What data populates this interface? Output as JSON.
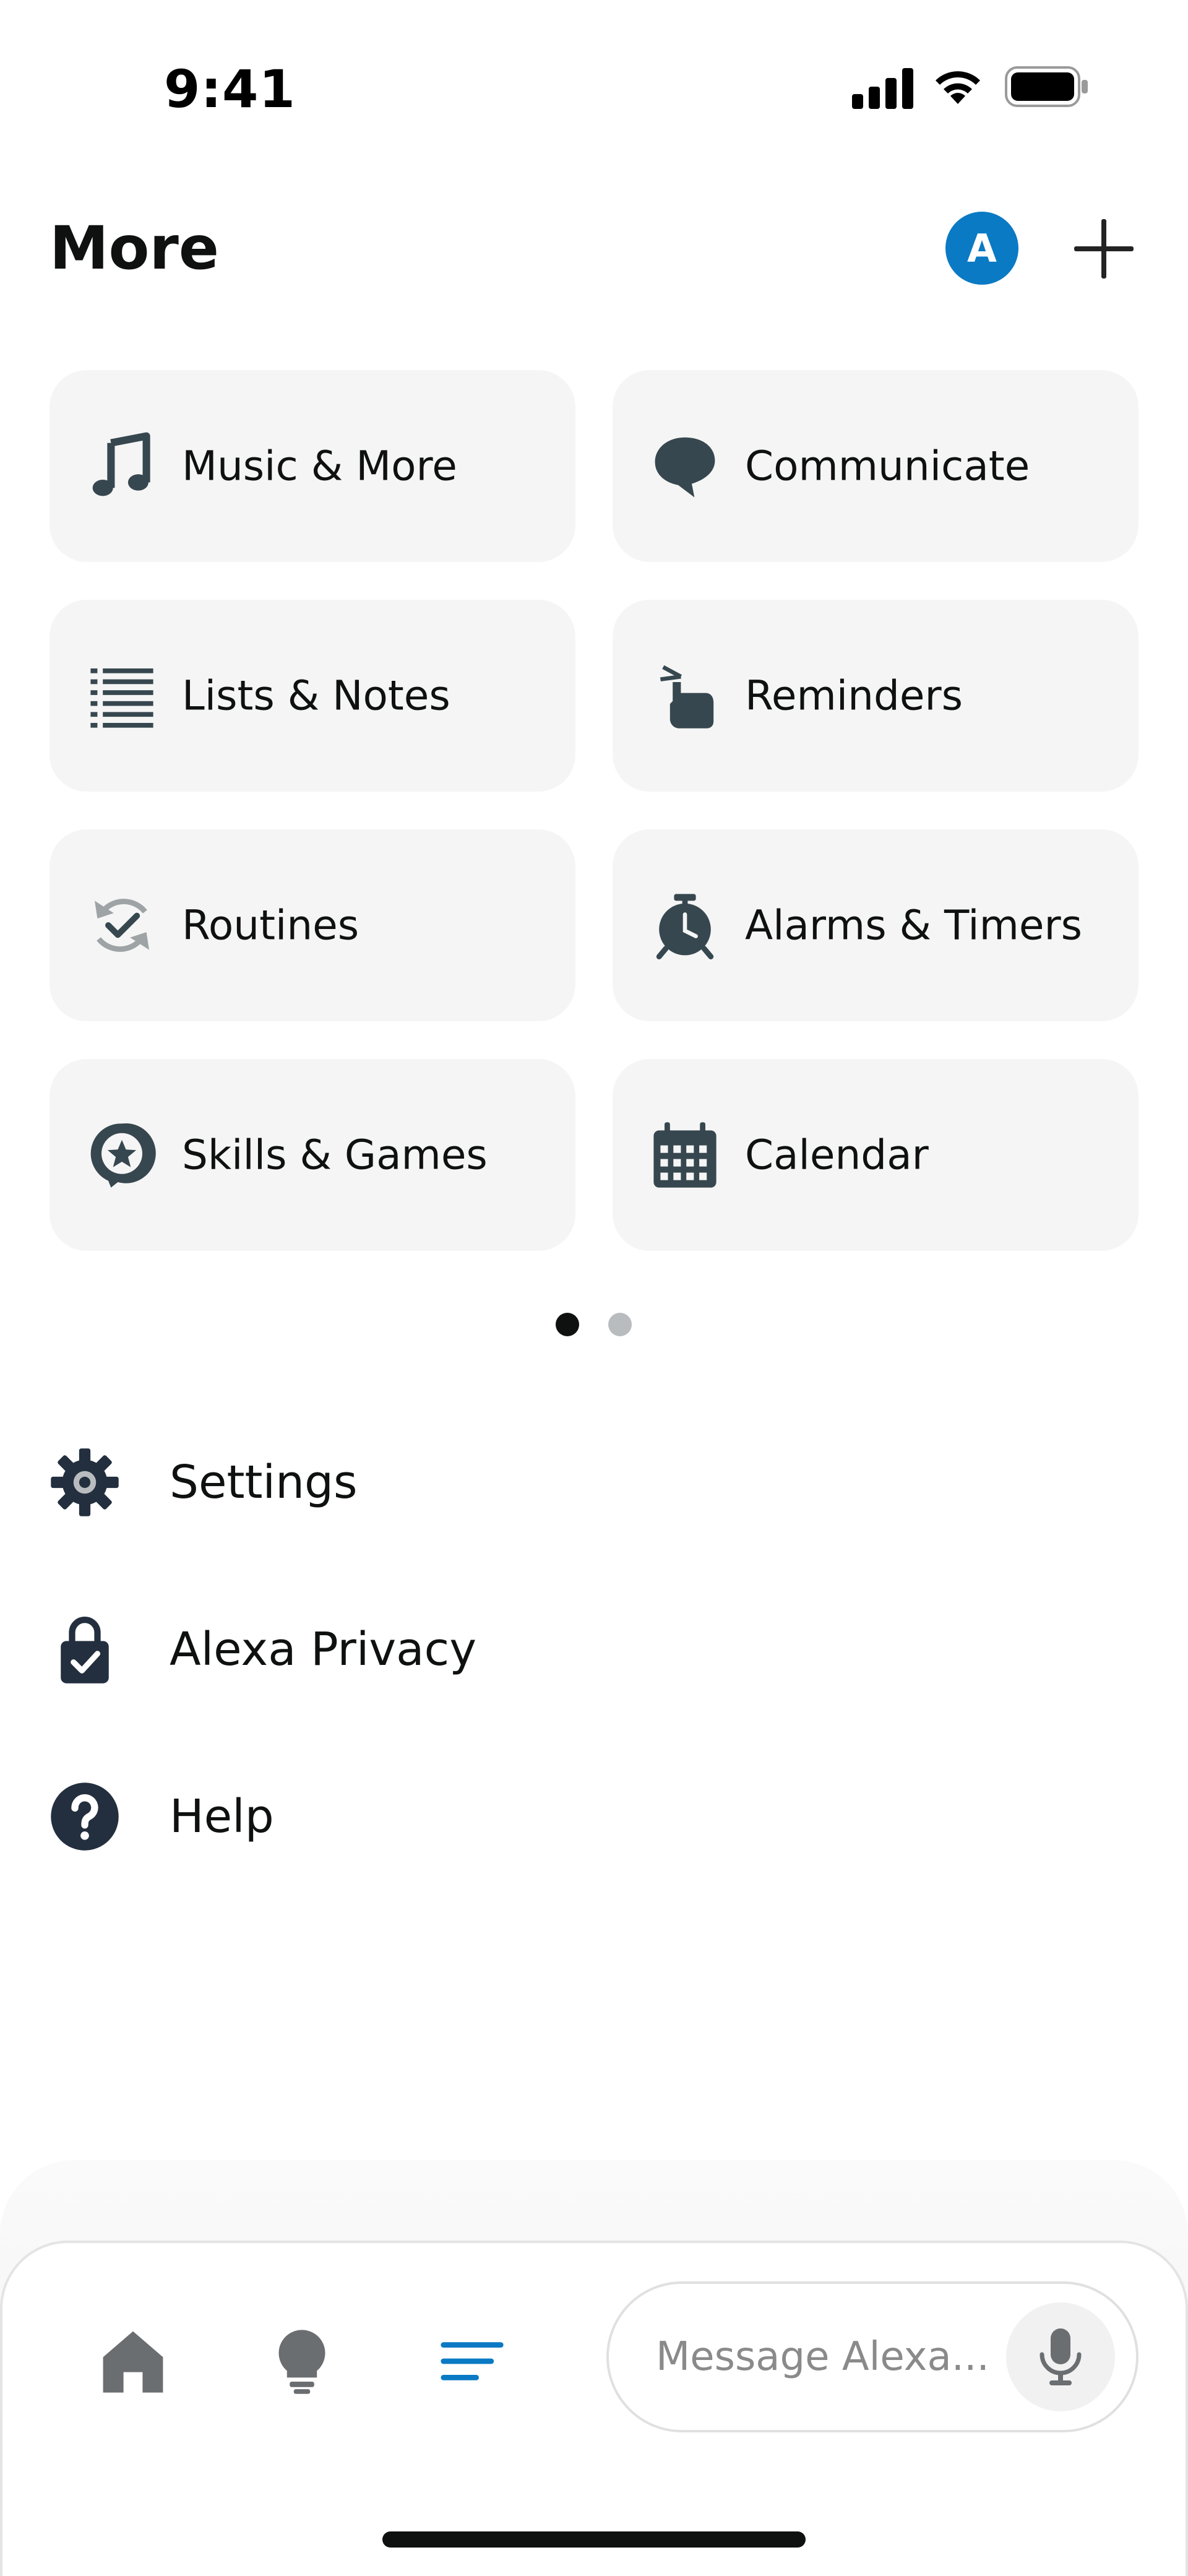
{
  "status_bar": {
    "time": "9:41",
    "icons": [
      "cellular-signal-icon",
      "wifi-icon",
      "battery-icon"
    ]
  },
  "header": {
    "title": "More",
    "avatar_initial": "A",
    "avatar_color": "#0a7ac4",
    "add_icon": "plus-icon"
  },
  "grid": {
    "page_count": 2,
    "active_page": 1,
    "tiles": [
      {
        "label": "Music & More",
        "icon": "music-note-icon"
      },
      {
        "label": "Communicate",
        "icon": "speech-bubble-icon"
      },
      {
        "label": "Lists & Notes",
        "icon": "list-icon"
      },
      {
        "label": "Reminders",
        "icon": "finger-string-icon"
      },
      {
        "label": "Routines",
        "icon": "routine-check-icon"
      },
      {
        "label": "Alarms & Timers",
        "icon": "alarm-clock-icon"
      },
      {
        "label": "Skills & Games",
        "icon": "star-bubble-icon"
      },
      {
        "label": "Calendar",
        "icon": "calendar-icon"
      }
    ]
  },
  "list": {
    "items": [
      {
        "label": "Settings",
        "icon": "gear-icon"
      },
      {
        "label": "Alexa Privacy",
        "icon": "privacy-lock-icon"
      },
      {
        "label": "Help",
        "icon": "help-icon"
      }
    ]
  },
  "bottom_nav": {
    "items": [
      {
        "icon": "home-icon",
        "active": false
      },
      {
        "icon": "lightbulb-icon",
        "active": false
      },
      {
        "icon": "more-menu-icon",
        "active": true
      }
    ],
    "active_color": "#0a7ac4",
    "inactive_color": "#6b6e70",
    "message": {
      "placeholder": "Message Alexa...",
      "value": "",
      "icon": "microphone-icon"
    }
  }
}
